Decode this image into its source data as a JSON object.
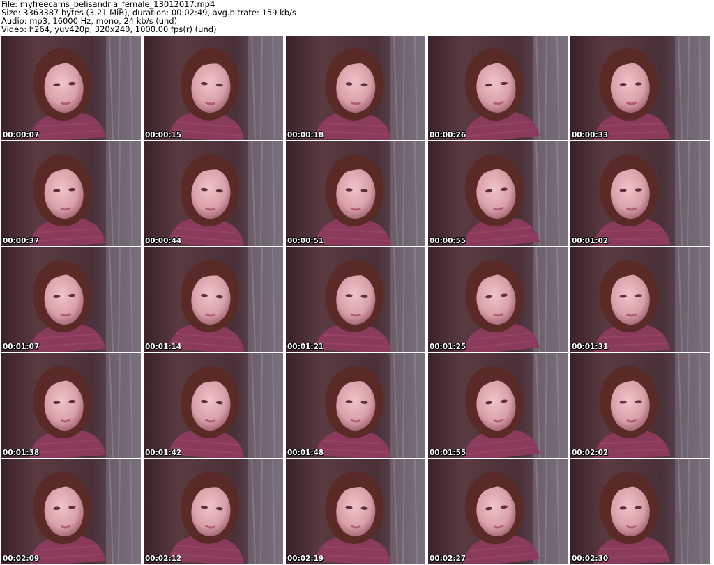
{
  "header": {
    "file_line": "File: myfreecams_belisandria_female_13012017.mp4",
    "size_line": "Size: 3363387 bytes (3.21 MiB), duration: 00:02:49, avg.bitrate: 159 kb/s",
    "audio_line": "Audio: mp3, 16000 Hz, mono, 24 kb/s (und)",
    "video_line": "Video: h264, yuv420p, 320x240, 1000.00 fps(r) (und)"
  },
  "thumbnails": [
    {
      "timestamp": "00:00:07"
    },
    {
      "timestamp": "00:00:15"
    },
    {
      "timestamp": "00:00:18"
    },
    {
      "timestamp": "00:00:26"
    },
    {
      "timestamp": "00:00:33"
    },
    {
      "timestamp": "00:00:37"
    },
    {
      "timestamp": "00:00:44"
    },
    {
      "timestamp": "00:00:51"
    },
    {
      "timestamp": "00:00:55"
    },
    {
      "timestamp": "00:01:02"
    },
    {
      "timestamp": "00:01:07"
    },
    {
      "timestamp": "00:01:14"
    },
    {
      "timestamp": "00:01:21"
    },
    {
      "timestamp": "00:01:25"
    },
    {
      "timestamp": "00:01:31"
    },
    {
      "timestamp": "00:01:38"
    },
    {
      "timestamp": "00:01:42"
    },
    {
      "timestamp": "00:01:48"
    },
    {
      "timestamp": "00:01:55"
    },
    {
      "timestamp": "00:02:02"
    },
    {
      "timestamp": "00:02:09"
    },
    {
      "timestamp": "00:02:12"
    },
    {
      "timestamp": "00:02:19"
    },
    {
      "timestamp": "00:02:27"
    },
    {
      "timestamp": "00:02:30"
    }
  ],
  "colors": {
    "background": "#ffffff",
    "header_text": "#000000",
    "timestamp_text": "#ffffff",
    "frame_bg": "#4a2a30",
    "curtain": "#6e6470",
    "hair": "#5a2a26",
    "skin": "#d8a0a8",
    "sweater": "#8a3a5a"
  }
}
